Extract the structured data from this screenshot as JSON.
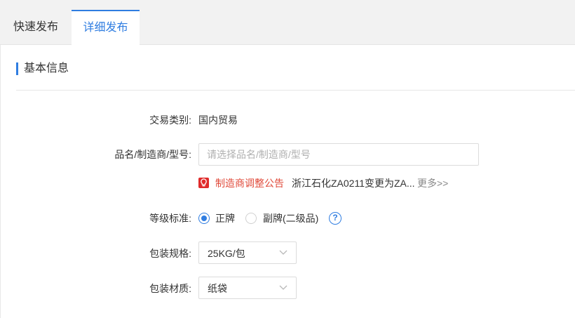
{
  "tabs": [
    {
      "label": "快速发布",
      "active": false
    },
    {
      "label": "详细发布",
      "active": true
    }
  ],
  "section": {
    "title": "基本信息"
  },
  "form": {
    "trade_type": {
      "label": "交易类别:",
      "value": "国内贸易"
    },
    "product": {
      "label": "品名/制造商/型号:",
      "placeholder": "请选择品名/制造商/型号",
      "value": ""
    },
    "notice": {
      "icon": "lightbulb-icon",
      "title": "制造商调整公告",
      "text": "浙江石化ZA0211变更为ZA...",
      "more": "更多>>"
    },
    "grade": {
      "label": "等级标准:",
      "options": [
        {
          "label": "正牌",
          "checked": true
        },
        {
          "label": "副牌(二级品)",
          "checked": false
        }
      ],
      "help": "?"
    },
    "package_spec": {
      "label": "包装规格:",
      "value": "25KG/包"
    },
    "package_material": {
      "label": "包装材质:",
      "value": "纸袋"
    }
  },
  "colors": {
    "accent": "#2f7de1",
    "notice": "#e04a3a"
  }
}
